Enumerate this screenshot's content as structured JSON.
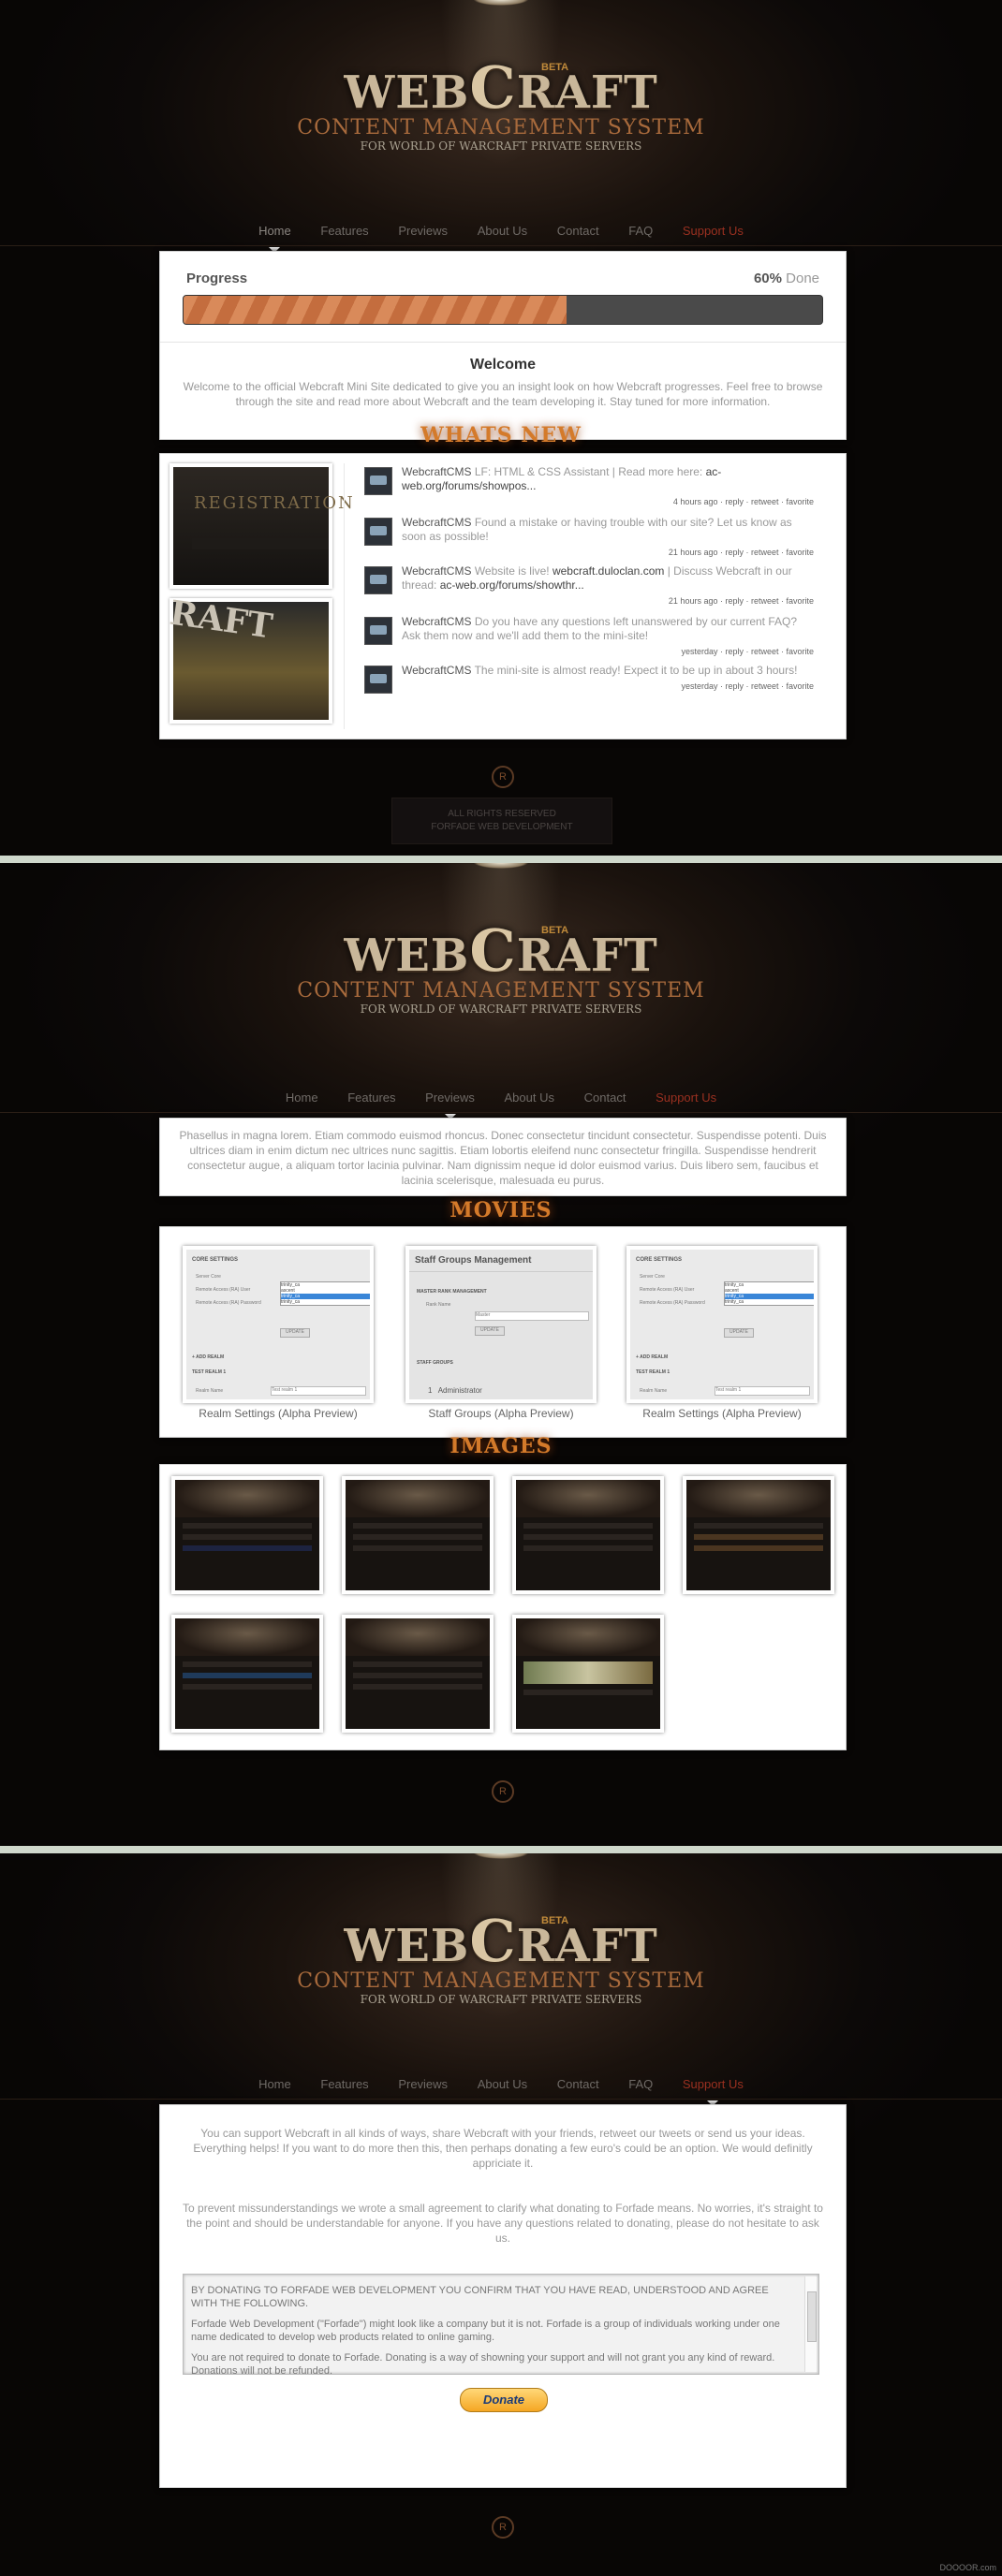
{
  "logo": {
    "title_left": "WEB",
    "title_big": "C",
    "title_right": "RAFT",
    "beta": "BETA",
    "subtitle": "CONTENT MANAGEMENT SYSTEM",
    "tagline": "FOR WORLD OF WARCRAFT PRIVATE SERVERS"
  },
  "nav": {
    "items": [
      "Home",
      "Features",
      "Previews",
      "About Us",
      "Contact",
      "FAQ",
      "Support Us"
    ]
  },
  "nav2": {
    "items": [
      "Home",
      "Features",
      "Previews",
      "About Us",
      "Contact",
      "Support Us"
    ]
  },
  "progress": {
    "title": "Progress",
    "percent": "60%",
    "done_label": "Done",
    "fraction": 0.6
  },
  "welcome": {
    "title": "Welcome",
    "text": "Welcome to the official Webcraft Mini Site dedicated to give you an insight look on how Webcraft progresses. Feel free to browse through the site and read more about Webcraft and the team developing it. Stay tuned for more information."
  },
  "whats_new": {
    "heading": "WHATS NEW",
    "thumb1": "REGISTRATION",
    "thumb2": "RAFT"
  },
  "tweets": [
    {
      "user": "WebcraftCMS",
      "text": "LF: HTML & CSS Assistant | Read more here:",
      "link": "ac-web.org/forums/showpos...",
      "time": "4 hours ago",
      "actions": "reply · retweet · favorite"
    },
    {
      "user": "WebcraftCMS",
      "text": "Found a mistake or having trouble with our site? Let us know as soon as possible!",
      "link": "",
      "time": "21 hours ago",
      "actions": "reply · retweet · favorite"
    },
    {
      "user": "WebcraftCMS",
      "text": "Website is live!",
      "link": "webcraft.duloclan.com",
      "text2": "| Discuss Webcraft in our thread:",
      "link2": "ac-web.org/forums/showthr...",
      "time": "21 hours ago",
      "actions": "reply · retweet · favorite"
    },
    {
      "user": "WebcraftCMS",
      "text": "Do you have any questions left unanswered by our current FAQ? Ask them now and we'll add them to the mini-site!",
      "link": "",
      "time": "yesterday",
      "actions": "reply · retweet · favorite"
    },
    {
      "user": "WebcraftCMS",
      "text": "The mini-site is almost ready! Expect it to be up in about 3 hours!",
      "link": "",
      "time": "yesterday",
      "actions": "reply · retweet · favorite"
    }
  ],
  "footer": {
    "emblem": "R",
    "rights": "ALL RIGHTS RESERVED",
    "company": "FORFADE WEB DEVELOPMENT"
  },
  "previews": {
    "intro": "Phasellus in magna lorem. Etiam commodo euismod rhoncus. Donec consectetur tincidunt consectetur. Suspendisse potenti. Duis ultrices diam in enim dictum nec ultrices nunc sagittis. Etiam lobortis eleifend nunc consectetur fringilla. Suspendisse hendrerit consectetur augue, a aliquam tortor lacinia pulvinar. Nam dignissim neque id dolor euismod varius. Duis libero sem, faucibus et lacinia scelerisque, malesuada eu purus.",
    "movies_heading": "MOVIES",
    "images_heading": "IMAGES",
    "movies": [
      {
        "caption": "Realm Settings (Alpha Preview)",
        "title": "CORE SETTINGS",
        "l1": "Server Core",
        "l2": "Remote Access (RA) User",
        "l3": "Remote Access (RA) Password",
        "btn": "UPDATE",
        "sub": "+ ADD REALM",
        "sub2": "TEST REALM 1",
        "l4": "Realm Name",
        "v4": "Test realm 1",
        "o1": "trinity_ca",
        "o2": "ascent",
        "o3": "trinity_ca",
        "o4": "trinity_ca"
      },
      {
        "caption": "Staff Groups (Alpha Preview)",
        "title": "Staff Groups Management",
        "s1": "MASTER RANK MANAGEMENT",
        "l1": "Rank Name",
        "v1": "Master",
        "btn": "UPDATE",
        "s2": "STAFF GROUPS",
        "r1": "1",
        "r1v": "Administrator"
      },
      {
        "caption": "Realm Settings (Alpha Preview)",
        "title": "CORE SETTINGS",
        "l1": "Server Core",
        "l2": "Remote Access (RA) User",
        "l3": "Remote Access (RA) Password",
        "btn": "UPDATE",
        "sub": "+ ADD REALM",
        "sub2": "TEST REALM 1",
        "l4": "Realm Name",
        "v4": "Test realm 1",
        "o1": "trinity_ca",
        "o2": "ascent",
        "o3": "trinity_ca",
        "o4": "trinity_ca"
      }
    ]
  },
  "support": {
    "p1": "You can support Webcraft in all kinds of ways, share Webcraft with your friends, retweet our tweets or send us your ideas. Everything helps! If you want to do more then this, then perhaps donating a few euro's could be an option. We would definitly appriciate it.",
    "p2": "To prevent missunderstandings we wrote a small agreement to clarify what donating to Forfade means. No worries, it's straight to the point and should be understandable for anyone. If you have any questions related to donating, please do not hesitate to ask us.",
    "t1": "BY DONATING TO FORFADE WEB DEVELOPMENT YOU CONFIRM THAT YOU HAVE READ, UNDERSTOOD AND AGREE WITH THE FOLLOWING.",
    "t2": "Forfade Web Development (\"Forfade\") might look like a company but it is not. Forfade is a group of individuals working under one name dedicated to develop web products related to online gaming.",
    "t3": "You are not required to donate to Forfade. Donating is a way of showning your support and will not grant you any kind of reward. Donations will not be refunded.",
    "donate": "Donate"
  },
  "watermark": "DOOOOR.com"
}
